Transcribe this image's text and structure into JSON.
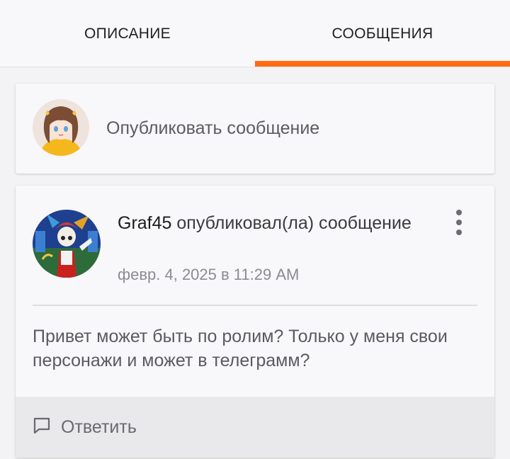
{
  "tabs": {
    "description": "ОПИСАНИЕ",
    "messages": "СООБЩЕНИЯ",
    "active": "messages"
  },
  "colors": {
    "accent": "#ff6a13",
    "background": "#f3f2f4",
    "card": "#f8f7f9",
    "footer": "#e9e8eb"
  },
  "compose": {
    "avatar": "user-avatar-anime-girl",
    "placeholder": "Опубликовать сообщение"
  },
  "post": {
    "avatar": "author-avatar-jester",
    "author": "Graf45",
    "action": " опубликовал(ла) сообщение",
    "date": "февр. 4, 2025 в 11:29 AM",
    "menu_icon": "more-vertical-icon",
    "body": "Привет может быть по ролим? Только у меня свои персонажи и может в телеграмм?",
    "reply_icon": "comment-icon",
    "reply_label": "Ответить"
  }
}
